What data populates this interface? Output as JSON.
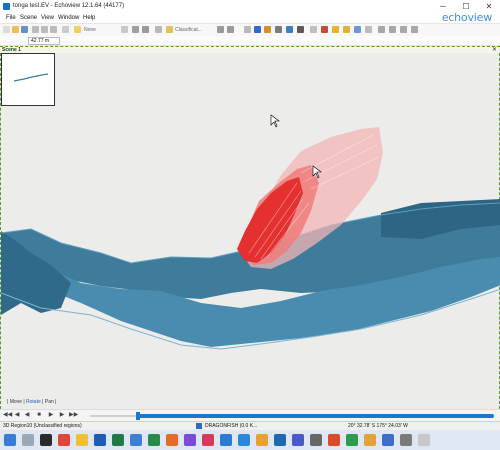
{
  "window": {
    "title": "tonga test.EV - Echoview 12.1.64 (44177)",
    "brand": "echoview",
    "controls": [
      "─",
      "☐",
      "✕"
    ]
  },
  "menu": [
    "File",
    "Scene",
    "View",
    "Window",
    "Help"
  ],
  "toolbar": {
    "none_label": "None",
    "classification_label": "Classificat..."
  },
  "depth_field": {
    "value": "42.77",
    "unit": "m"
  },
  "scene": {
    "tab_label": "Scene 1",
    "close_glyph": "✕",
    "navigation": {
      "move": "Move",
      "rotate": "Rotate",
      "pan": "Pan",
      "separator": "|"
    }
  },
  "playback": [
    "◀◀",
    "◀",
    "◀",
    "■",
    "▶",
    "▶",
    "▶▶"
  ],
  "status": {
    "region": "3D Region10 (Unclassified regions)",
    "vessel": "DRAGONFISH (0.0 K...",
    "position": "20° 32.78' S 175° 24.03' W"
  },
  "colors": {
    "water_column_red": "#e53030",
    "seafloor_blue": "#3f7c9c",
    "accent": "#1a78d4"
  }
}
